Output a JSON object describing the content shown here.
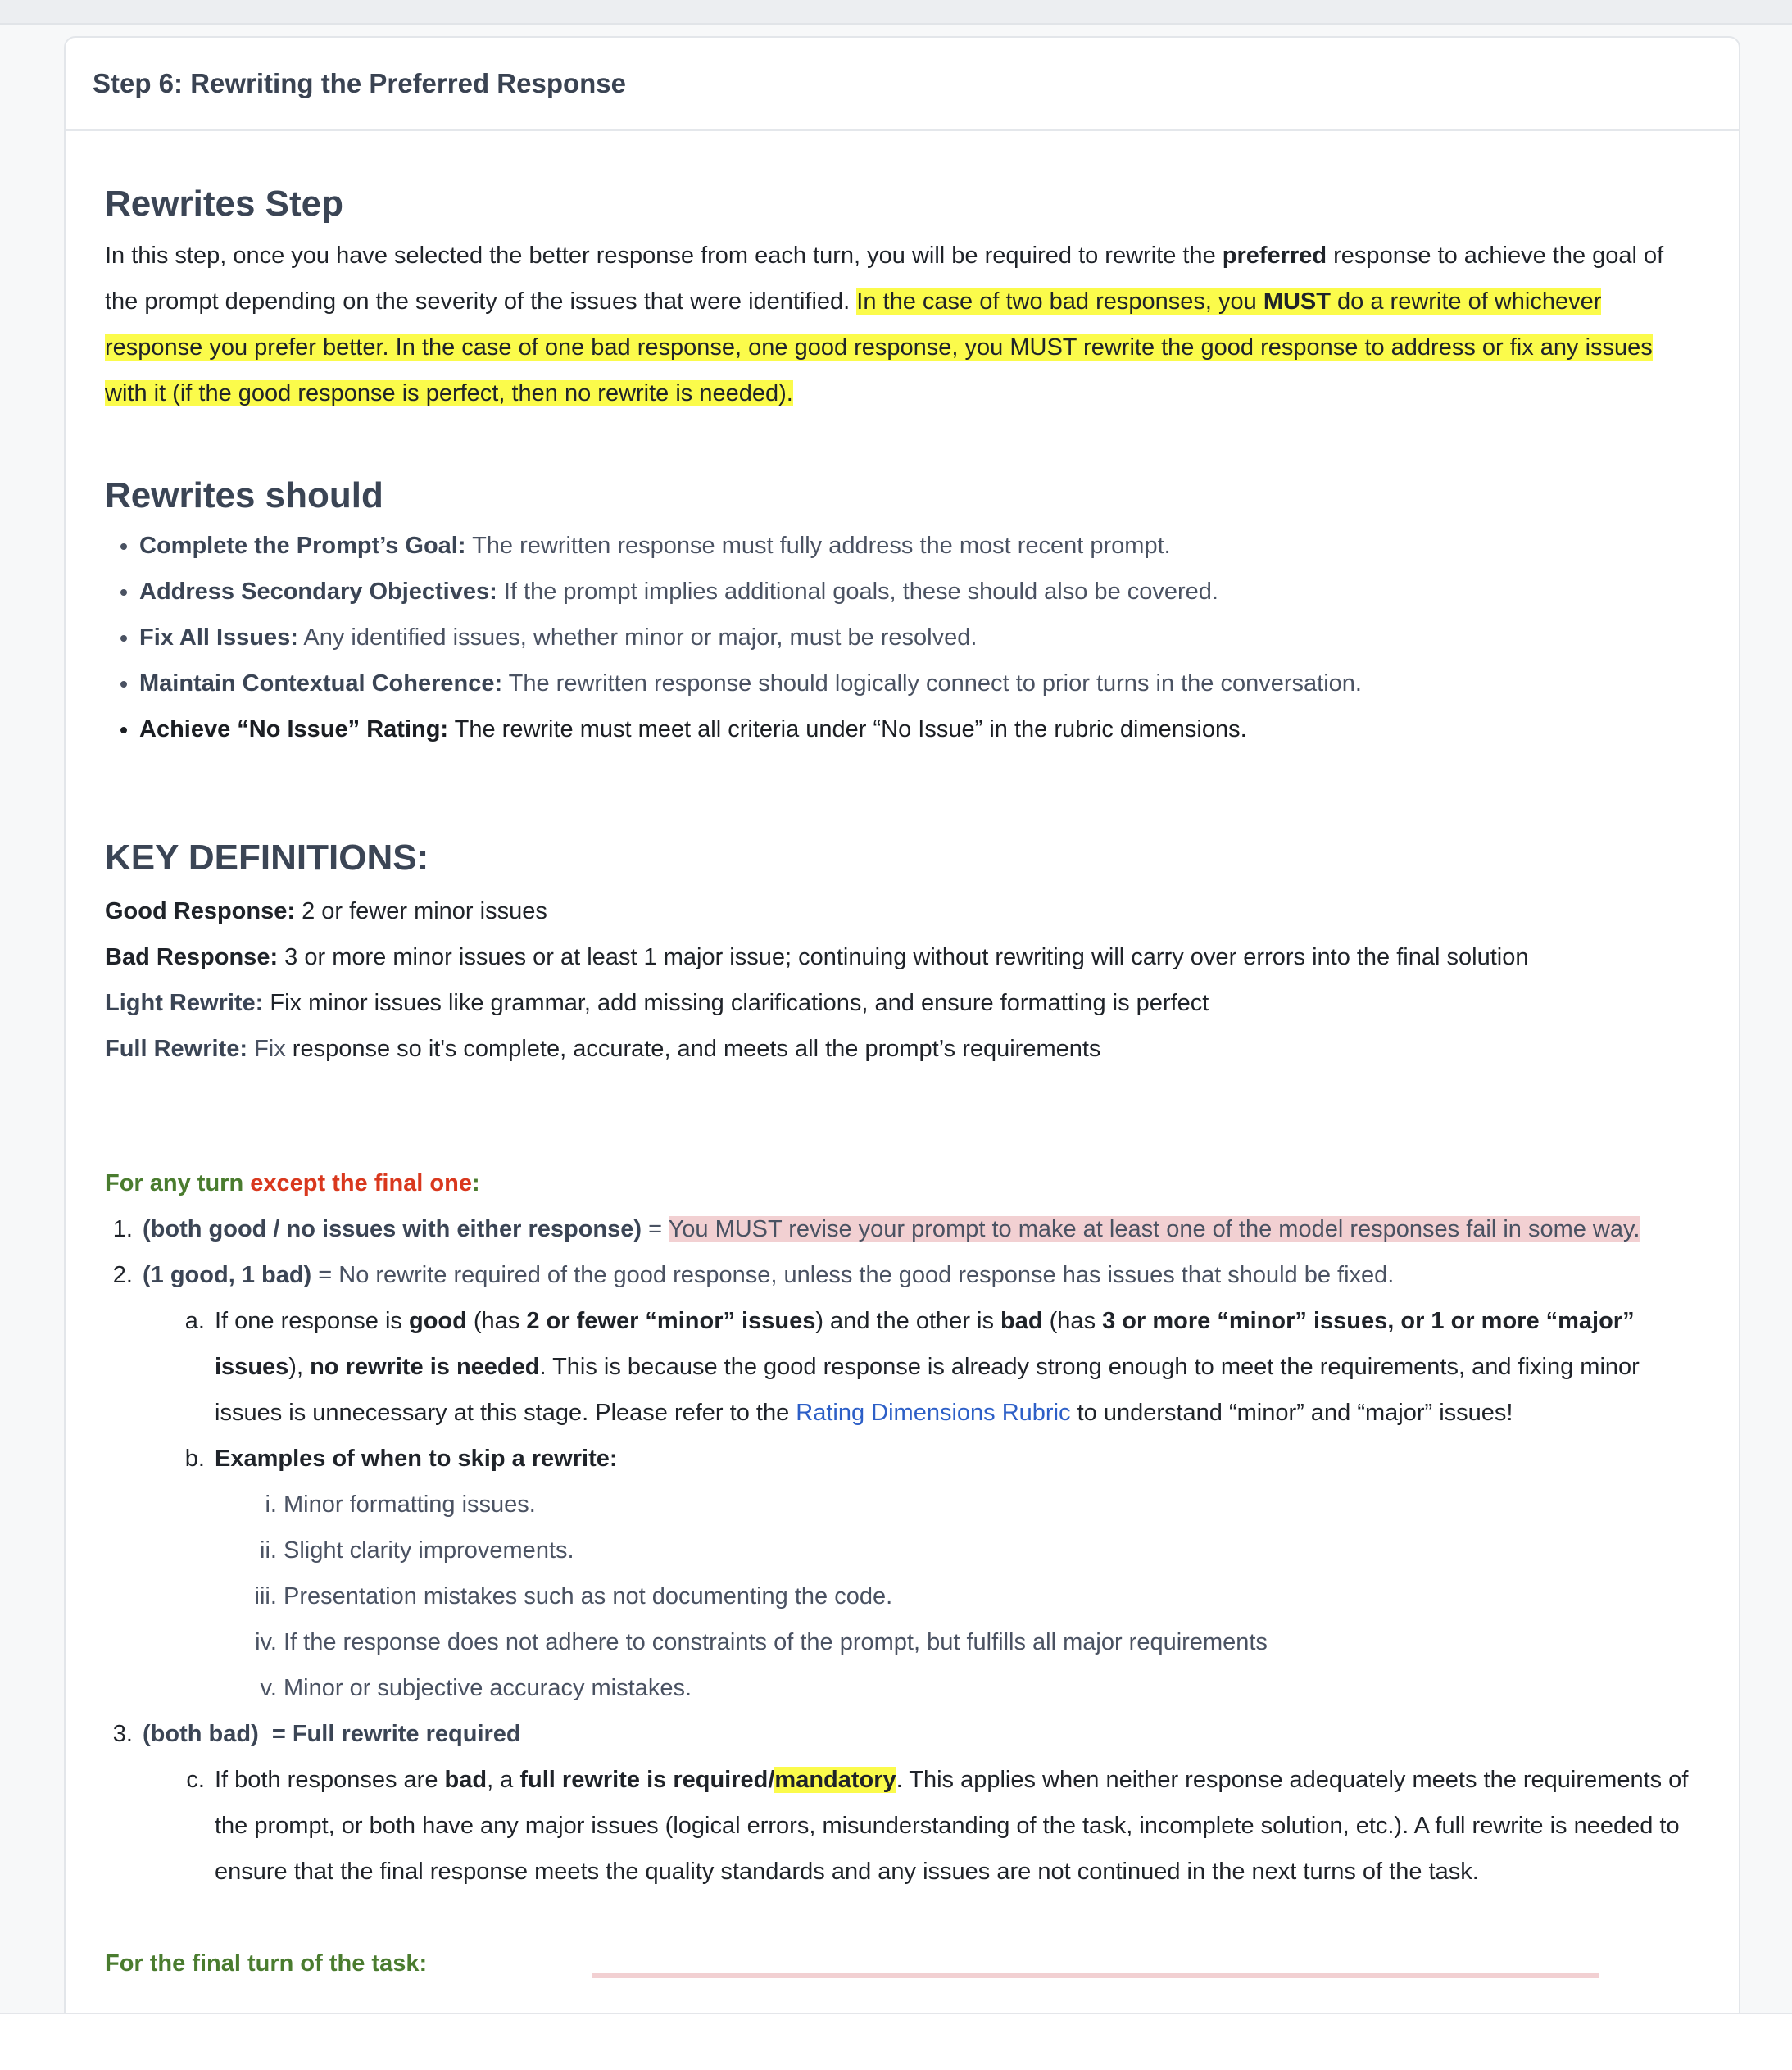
{
  "card": {
    "title": "Step 6: Rewriting the Preferred Response"
  },
  "rewrites": {
    "heading": "Rewrites Step",
    "p1": "In this step, once you have selected the better response from each turn, you will be required to rewrite the ",
    "p1_bold": "preferred",
    "p2": " response to achieve the goal of the prompt depending on the severity of the issues that were identified. ",
    "hl1": "In the case of two bad responses, you ",
    "hl1_bold": "MUST",
    "hl2": " do a rewrite of whichever response you prefer better. In the case of one bad response, one good response, you MUST rewrite the good response to address or fix any issues with it (if the good response is perfect, then no rewrite is needed)."
  },
  "should": {
    "heading": "Rewrites should",
    "items": [
      {
        "label": "Complete the Prompt’s Goal:",
        "text": " The rewritten response must fully address the most recent prompt."
      },
      {
        "label": "Address Secondary Objectives:",
        "text": " If the prompt implies additional goals, these should also be covered."
      },
      {
        "label": "Fix All Issues:",
        "text": " Any identified issues, whether minor or major, must be resolved."
      },
      {
        "label": "Maintain Contextual Coherence:",
        "text": " The rewritten response should logically connect to prior turns in the conversation."
      },
      {
        "label": "Achieve “No Issue” Rating:",
        "text": " The rewrite must meet all criteria under “No Issue” in the rubric dimensions."
      }
    ]
  },
  "keydefs": {
    "heading": "KEY DEFINITIONS:",
    "items": [
      {
        "label": "Good Response:",
        "text": " 2 or fewer minor issues"
      },
      {
        "label": "Bad Response:",
        "text": " 3 or more minor issues or at least 1 major issue; continuing without rewriting will carry over errors into the final solution"
      },
      {
        "label": "Light Rewrite:",
        "text": " Fix minor issues like grammar, add missing clarifications, and ensure formatting is perfect"
      },
      {
        "label": "Full Rewrite:",
        "text_gray": " Fix",
        "text": " response so it's complete, accurate, and meets all the prompt’s requirements"
      }
    ]
  },
  "turns": {
    "head_green": "For any turn ",
    "head_red": "except the final one",
    "head_colon": ":",
    "item1_label": "(both good / no issues with either response)",
    "item1_eq": " = ",
    "item1_text": "You MUST revise your prompt to make at least one of the model responses fail in some way.",
    "item2_label": "(1 good, 1 bad)",
    "item2_text": " = No rewrite required of the good response, unless the good response has issues that should be fixed.",
    "a": {
      "t1": "If one response is ",
      "b1": "good",
      "t2": " (has ",
      "b2": "2 or fewer “minor” issues",
      "t3": ") and the other is ",
      "b3": "bad",
      "t4": " (has ",
      "b4": "3 or more “minor” issues, or 1 or more “major” issues",
      "t5": "), ",
      "b5": "no rewrite is needed",
      "t6": ". This is because the good response is already strong enough to meet the requirements, and fixing minor issues is unnecessary at this stage. Please refer to the ",
      "link": "Rating Dimensions Rubric",
      "t7": " to understand “minor” and “major” issues!"
    },
    "b_label": "Examples of when to skip a rewrite:",
    "skip_examples": [
      "Minor formatting issues.",
      "Slight clarity improvements.",
      "Presentation mistakes such as not documenting the code.",
      "If the response does not adhere to constraints of the prompt, but fulfills all major requirements",
      "Minor or subjective accuracy mistakes."
    ],
    "item3_label": "(both bad)",
    "item3_text": "  = Full rewrite required",
    "c": {
      "t1": "If both responses are ",
      "b1": "bad",
      "t2": ", a ",
      "b2": "full rewrite is required/",
      "b2_hl": "mandatory",
      "t3": ". This applies when neither response adequately meets the requirements of the prompt, or both have any major issues (logical errors, misunderstanding of the task, incomplete solution, etc.). A full rewrite is needed to ensure that the final response meets the quality standards and any issues are not continued in the next turns of the task."
    },
    "final_head": "For the final turn of the task:"
  }
}
